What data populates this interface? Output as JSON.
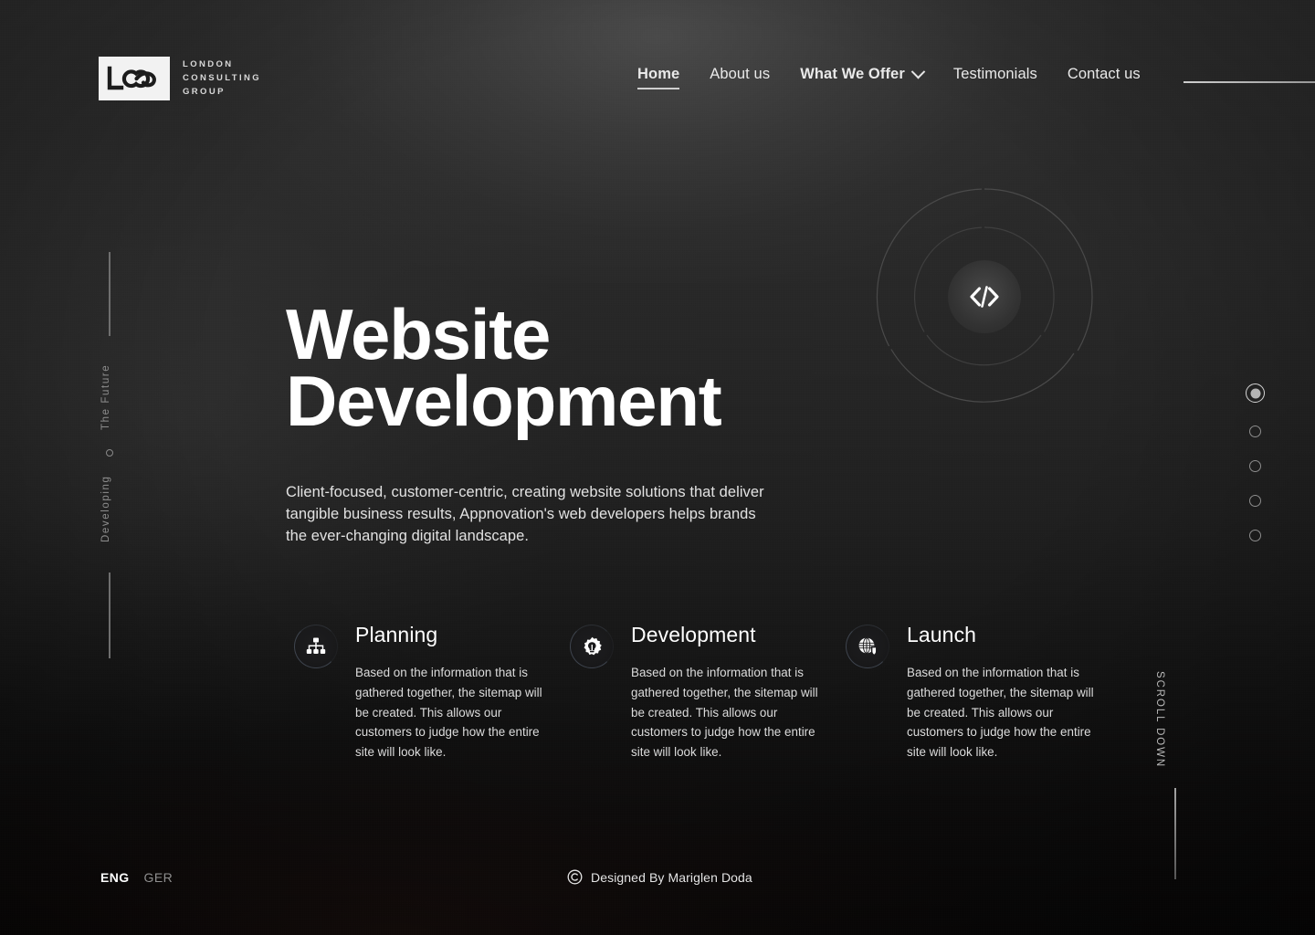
{
  "brand": {
    "monogram": "LCG",
    "name_lines": [
      "LONDON",
      "CONSULTING",
      "GROUP"
    ]
  },
  "nav": {
    "items": [
      {
        "label": "Home",
        "active": true,
        "bold": true,
        "dropdown": false
      },
      {
        "label": "About us",
        "active": false,
        "bold": false,
        "dropdown": false
      },
      {
        "label": "What We Offer",
        "active": false,
        "bold": true,
        "dropdown": true
      },
      {
        "label": "Testimonials",
        "active": false,
        "bold": false,
        "dropdown": false
      },
      {
        "label": "Contact us",
        "active": false,
        "bold": false,
        "dropdown": false
      }
    ]
  },
  "rail": {
    "top_label": "The Future",
    "bottom_label": "Developing"
  },
  "hero": {
    "title_line1": "Website",
    "title_line2": "Development",
    "subtitle": "Client-focused, customer-centric, creating website solutions that deliver tangible business results, Appnovation's web developers helps brands the ever-changing digital landscape."
  },
  "graphic": {
    "icon": "code-icon"
  },
  "slider": {
    "total": 5,
    "active_index": 0
  },
  "cards": [
    {
      "icon": "sitemap-icon",
      "title": "Planning",
      "text": "Based on the information that is gathered together, the sitemap will be created. This allows our customers to judge how the entire site will look like."
    },
    {
      "icon": "gear-bulb-icon",
      "title": "Development",
      "text": "Based on the information that is gathered together, the sitemap will be created. This allows our customers to judge how the entire site will look like."
    },
    {
      "icon": "globe-shield-icon",
      "title": "Launch",
      "text": "Based on the information that is gathered together, the sitemap will be created. This allows our customers to judge how the entire site will look like."
    }
  ],
  "scroll": {
    "label": "SCROLL DOWN"
  },
  "footer": {
    "languages": [
      {
        "label": "ENG",
        "active": true
      },
      {
        "label": "GER",
        "active": false
      }
    ],
    "credit": "Designed By Mariglen Doda",
    "credit_icon": "copyright-icon"
  },
  "colors": {
    "background_top": "#2e2e2e",
    "background_bottom": "#090808",
    "text_primary": "#ffffff",
    "text_muted": "#8f8f8f",
    "accent_ring": "#606a7c"
  }
}
